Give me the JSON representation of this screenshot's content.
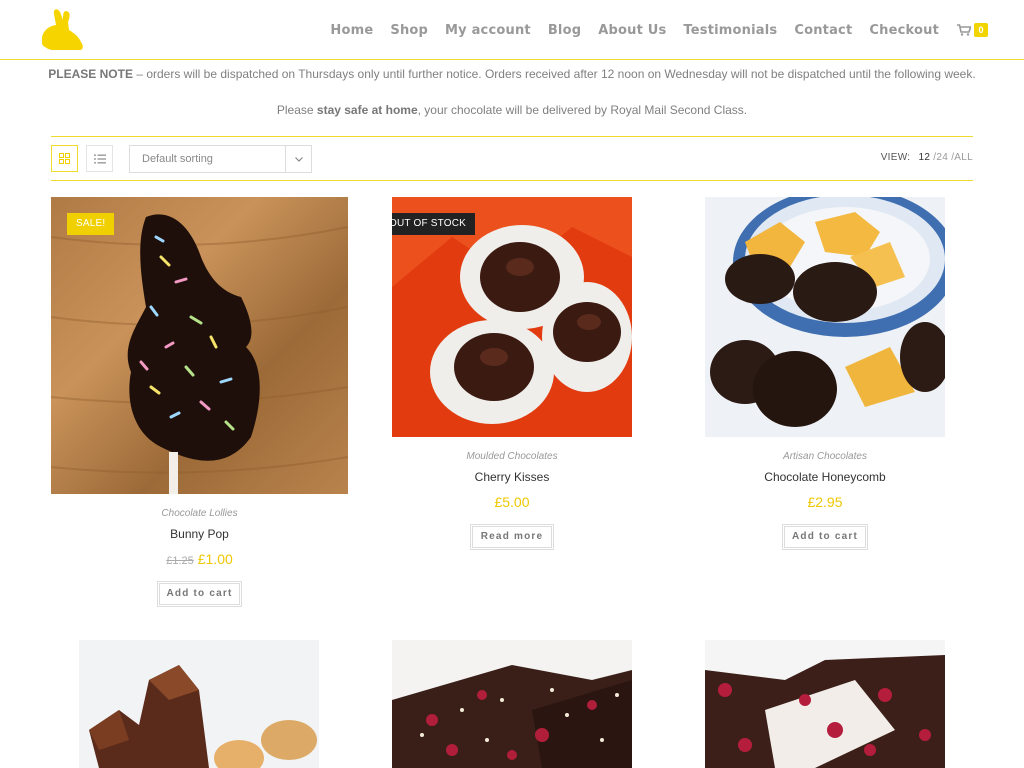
{
  "header": {
    "nav": [
      "Home",
      "Shop",
      "My account",
      "Blog",
      "About Us",
      "Testimonials",
      "Contact",
      "Checkout"
    ],
    "cart_count": "0"
  },
  "notice": {
    "line1_bold": "PLEASE NOTE",
    "line1_rest": " – orders will be dispatched on Thursdays only until further notice. Orders received after 12 noon on Wednesday will not be dispatched until the following week.",
    "line2_pre": "Please ",
    "line2_bold": "stay safe at home",
    "line2_post": ", your chocolate will be delivered by Royal Mail Second Class."
  },
  "toolbar": {
    "sort_label": "Default sorting",
    "view_label": "VIEW:",
    "view_options": [
      "12",
      "24",
      "ALL"
    ],
    "view_sep": "/"
  },
  "products": [
    {
      "category": "Chocolate Lollies",
      "name": "Bunny Pop",
      "old_price": "£1.25",
      "price": "£1.00",
      "button": "Add to cart",
      "badge": "SALE!"
    },
    {
      "category": "Moulded Chocolates",
      "name": "Cherry Kisses",
      "price": "£5.00",
      "button": "Read more",
      "badge": "OUT OF STOCK"
    },
    {
      "category": "Artisan Chocolates",
      "name": "Chocolate Honeycomb",
      "price": "£2.95",
      "button": "Add to cart"
    }
  ],
  "colors": {
    "accent": "#f0d000",
    "border": "#f0dc2f"
  }
}
